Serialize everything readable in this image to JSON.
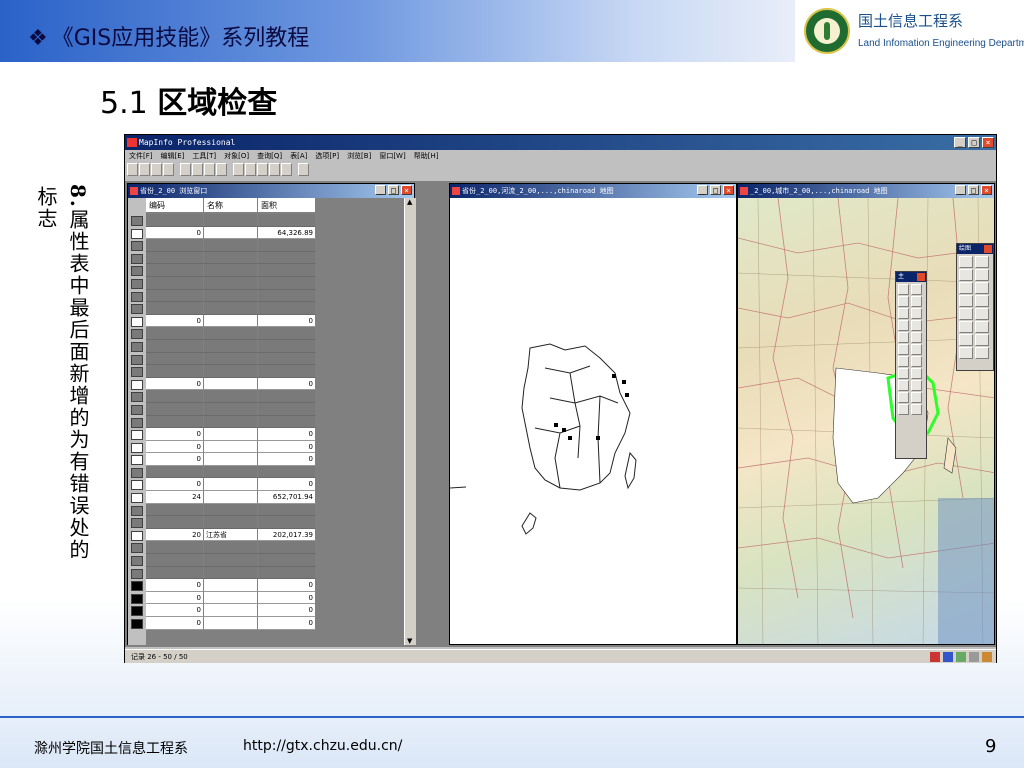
{
  "slide": {
    "course_title": "《GIS应用技能》系列教程",
    "bullet": "❖",
    "dept_cn": "国土信息工程系",
    "dept_en": "Land Infomation Engineering Department",
    "section_number": "5.1",
    "section_name": "区域检查",
    "note_number": "8.",
    "note_text_1": "属性表中最后面新增的为有错误处的",
    "note_text_2": "标志",
    "footer_school": "滁州学院国土信息工程系",
    "footer_url": "http://gtx.chzu.edu.cn/",
    "page_number": "9"
  },
  "app": {
    "title": "MapInfo Professional",
    "menu": [
      "文件[F]",
      "编辑[E]",
      "工具[T]",
      "对象[O]",
      "查询[Q]",
      "表[A]",
      "选项[P]",
      "浏览[B]",
      "窗口[W]",
      "帮助[H]"
    ],
    "status_text": "记录 26 - 50 / 50",
    "window_buttons": {
      "min": "_",
      "max": "□",
      "close": "×"
    }
  },
  "browser": {
    "title": "省份_2_00 浏览窗口",
    "columns": [
      "编码",
      "名称",
      "面积"
    ],
    "rows": [
      {
        "style": "dark",
        "code": "",
        "name": "",
        "area": ""
      },
      {
        "style": "light",
        "code": "0",
        "name": "",
        "area": "64,326.89"
      },
      {
        "style": "dark",
        "code": "",
        "name": "",
        "area": ""
      },
      {
        "style": "dark",
        "code": "",
        "name": "",
        "area": ""
      },
      {
        "style": "dark",
        "code": "",
        "name": "",
        "area": ""
      },
      {
        "style": "dark",
        "code": "",
        "name": "",
        "area": ""
      },
      {
        "style": "dark",
        "code": "",
        "name": "",
        "area": ""
      },
      {
        "style": "dark",
        "code": "",
        "name": "",
        "area": ""
      },
      {
        "style": "light",
        "code": "0",
        "name": "",
        "area": "0"
      },
      {
        "style": "dark",
        "code": "",
        "name": "",
        "area": ""
      },
      {
        "style": "dark",
        "code": "",
        "name": "",
        "area": ""
      },
      {
        "style": "dark",
        "code": "",
        "name": "",
        "area": ""
      },
      {
        "style": "dark",
        "code": "",
        "name": "",
        "area": ""
      },
      {
        "style": "light",
        "code": "0",
        "name": "",
        "area": "0"
      },
      {
        "style": "dark",
        "code": "",
        "name": "",
        "area": ""
      },
      {
        "style": "dark",
        "code": "",
        "name": "",
        "area": ""
      },
      {
        "style": "dark",
        "code": "",
        "name": "",
        "area": ""
      },
      {
        "style": "light",
        "code": "0",
        "name": "",
        "area": "0"
      },
      {
        "style": "light",
        "code": "0",
        "name": "",
        "area": "0"
      },
      {
        "style": "light",
        "code": "0",
        "name": "",
        "area": "0"
      },
      {
        "style": "dark",
        "code": "",
        "name": "",
        "area": ""
      },
      {
        "style": "light",
        "code": "0",
        "name": "",
        "area": "0"
      },
      {
        "style": "light",
        "code": "24",
        "name": "",
        "area": "652,701.94"
      },
      {
        "style": "dark",
        "code": "",
        "name": "",
        "area": ""
      },
      {
        "style": "dark",
        "code": "",
        "name": "",
        "area": ""
      },
      {
        "style": "light",
        "code": "20",
        "name": "江苏省",
        "area": "202,017.39"
      },
      {
        "style": "dark",
        "code": "",
        "name": "",
        "area": ""
      },
      {
        "style": "dark",
        "code": "",
        "name": "",
        "area": ""
      },
      {
        "style": "dark",
        "code": "",
        "name": "",
        "area": ""
      },
      {
        "style": "black",
        "code": "0",
        "name": "",
        "area": "0"
      },
      {
        "style": "black",
        "code": "0",
        "name": "",
        "area": "0"
      },
      {
        "style": "black",
        "code": "0",
        "name": "",
        "area": "0"
      },
      {
        "style": "black",
        "code": "0",
        "name": "",
        "area": "0"
      }
    ]
  },
  "map1": {
    "title": "省份_2_00,河流_2_00,...,chinaroad 地图"
  },
  "map2": {
    "title": "_2_00,城市_2_00,...,chinaroad 地图"
  },
  "main_palette": {
    "title": "主"
  },
  "draw_palette": {
    "title": "绘图"
  },
  "colors": {
    "accent": "#2a62c8",
    "titlebar": "#0a246a",
    "error_highlight": "#2bff2b"
  }
}
